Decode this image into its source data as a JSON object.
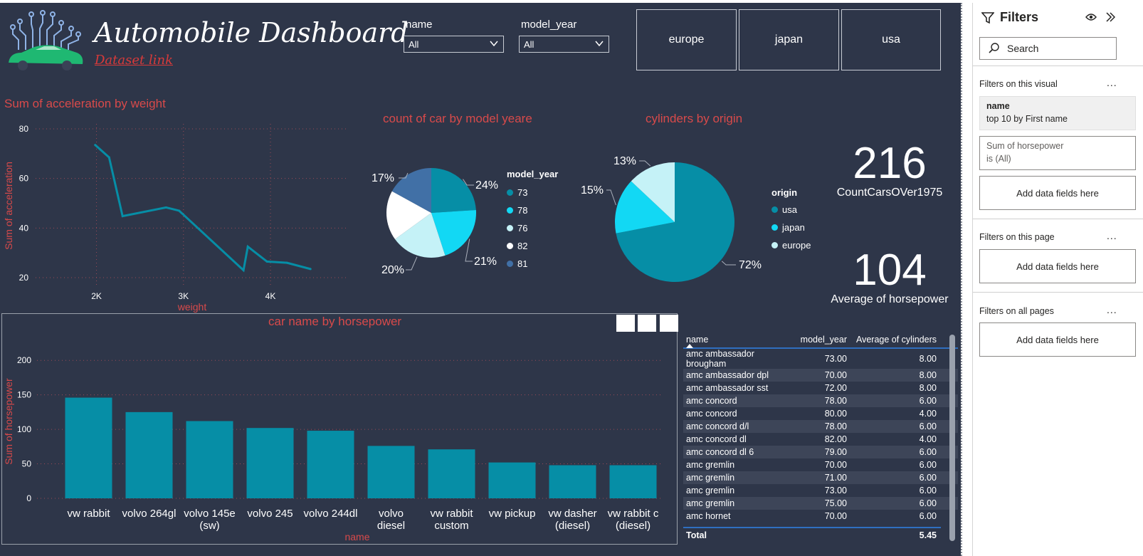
{
  "header": {
    "title": "Automobile Dashboard",
    "link_text": "Dataset link"
  },
  "slicers": [
    {
      "label": "name",
      "value": "All"
    },
    {
      "label": "model_year",
      "value": "All"
    }
  ],
  "origin_tiles": [
    "europe",
    "japan",
    "usa"
  ],
  "colors": {
    "background": "#2e3649",
    "teal": "#068ea6",
    "cyan": "#12d8f4",
    "light_cyan": "#c5f2f7",
    "white": "#ffffff",
    "steel_blue": "#4170a6",
    "title_red": "#d84a4a"
  },
  "line_chart": {
    "title": "Sum of acceleration by weight",
    "xlabel": "weight",
    "ylabel": "Sum of acceleration",
    "x_ticks": [
      "2K",
      "3K",
      "4K"
    ],
    "y_ticks": [
      "20",
      "40",
      "60",
      "80"
    ],
    "chart_data": {
      "type": "line",
      "x": [
        1985,
        2145,
        2300,
        2800,
        2950,
        3690,
        3740,
        3960,
        4190,
        4460
      ],
      "y": [
        73.5,
        68.5,
        44.8,
        48.3,
        47,
        23,
        32.5,
        26.5,
        26,
        23.5
      ],
      "xlim": [
        1300,
        4900
      ],
      "ylim": [
        16,
        82
      ]
    }
  },
  "model_year_pie": {
    "title": "count of car by model yeare",
    "legend_title": "model_year",
    "chart_data": {
      "type": "pie",
      "labels": [
        "73",
        "78",
        "76",
        "82",
        "81"
      ],
      "values": [
        24,
        21,
        20,
        18,
        17
      ],
      "display_labels": [
        "24%",
        "21%",
        "20%",
        "",
        "17%"
      ]
    }
  },
  "origin_pie": {
    "title": "cylinders by origin",
    "legend_title": "origin",
    "chart_data": {
      "type": "pie",
      "labels": [
        "usa",
        "japan",
        "europe"
      ],
      "values": [
        72,
        15,
        13
      ],
      "display_labels": [
        "72%",
        "15%",
        "13%"
      ]
    }
  },
  "kpis": [
    {
      "value": "216",
      "label": "CountCarsOVer1975"
    },
    {
      "value": "104",
      "label": "Average of horsepower"
    }
  ],
  "bar_chart": {
    "title": "car name by horsepower",
    "xlabel": "name",
    "ylabel": "Sum of horsepower",
    "y_ticks": [
      "0",
      "50",
      "100",
      "150",
      "200"
    ],
    "chart_data": {
      "type": "bar",
      "categories": [
        [
          "vw rabbit"
        ],
        [
          "volvo 264gl"
        ],
        [
          "volvo 145e",
          "(sw)"
        ],
        [
          "volvo 245"
        ],
        [
          "volvo 244dl"
        ],
        [
          "volvo",
          "diesel"
        ],
        [
          "vw rabbit",
          "custom"
        ],
        [
          "vw pickup"
        ],
        [
          "vw dasher",
          "(diesel)"
        ],
        [
          "vw rabbit c",
          "(diesel)"
        ]
      ],
      "values": [
        146,
        125,
        112,
        102,
        98,
        76,
        71,
        52,
        48,
        48
      ],
      "ylim": [
        0,
        225
      ]
    }
  },
  "table": {
    "columns": [
      "name",
      "model_year",
      "Average of cylinders"
    ],
    "rows": [
      [
        "amc ambassador brougham",
        "73.00",
        "8.00"
      ],
      [
        "amc ambassador dpl",
        "70.00",
        "8.00"
      ],
      [
        "amc ambassador sst",
        "72.00",
        "8.00"
      ],
      [
        "amc concord",
        "78.00",
        "6.00"
      ],
      [
        "amc concord",
        "80.00",
        "4.00"
      ],
      [
        "amc concord d/l",
        "78.00",
        "6.00"
      ],
      [
        "amc concord dl",
        "82.00",
        "4.00"
      ],
      [
        "amc concord dl 6",
        "79.00",
        "6.00"
      ],
      [
        "amc gremlin",
        "70.00",
        "6.00"
      ],
      [
        "amc gremlin",
        "71.00",
        "6.00"
      ],
      [
        "amc gremlin",
        "73.00",
        "6.00"
      ],
      [
        "amc gremlin",
        "75.00",
        "6.00"
      ],
      [
        "amc hornet",
        "70.00",
        "6.00"
      ]
    ],
    "total_label": "Total",
    "total_value": "5.45"
  },
  "filters_pane": {
    "title": "Filters",
    "search_placeholder": "Search",
    "section_visual": "Filters on this visual",
    "card_name_title": "name",
    "card_name_sub": "top 10 by First name",
    "card_hp_title": "Sum of horsepower",
    "card_hp_sub": "is (All)",
    "add_fields": "Add data fields here",
    "section_page": "Filters on this page",
    "section_all": "Filters on all pages",
    "ellipsis": "..."
  }
}
